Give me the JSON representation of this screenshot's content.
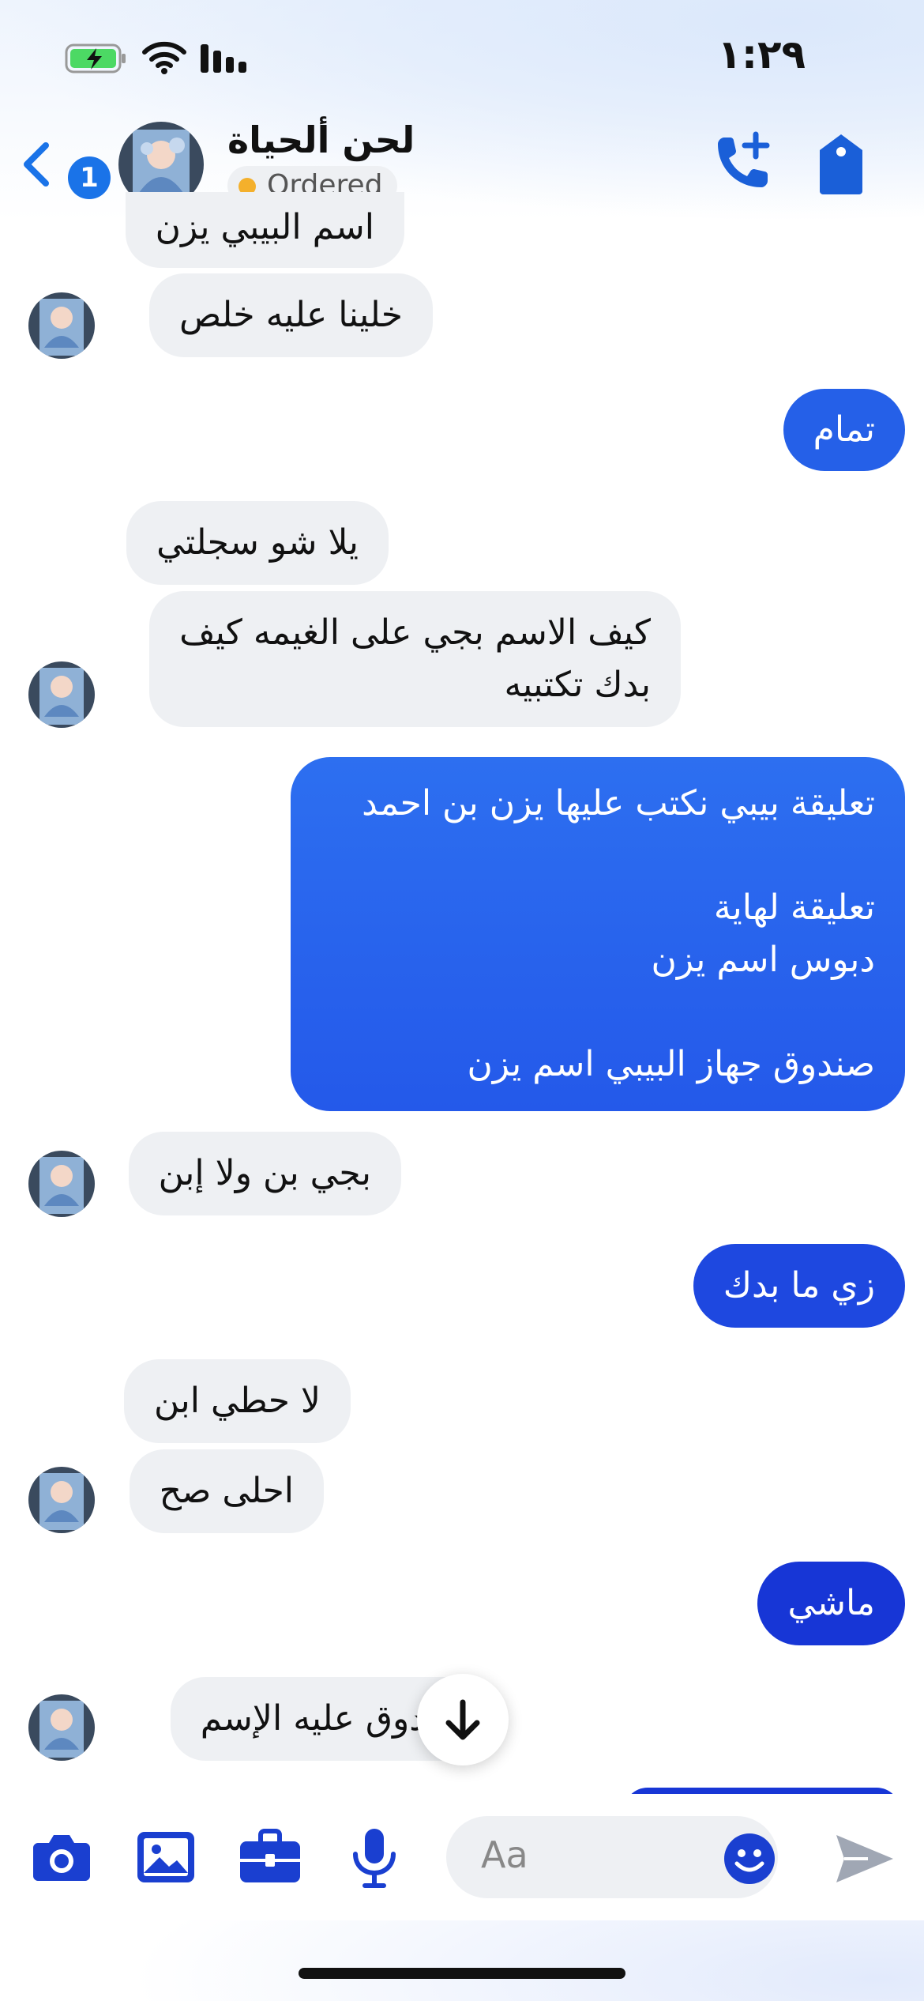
{
  "status_bar": {
    "time": "١:٢٩"
  },
  "header": {
    "contact_name": "لحن ألحياة",
    "status_chip": "Ordered",
    "unread_count": "1"
  },
  "messages": [
    {
      "side": "in",
      "text": "اسم البيبي يزن"
    },
    {
      "side": "in",
      "text": "خلينا عليه خلص"
    },
    {
      "side": "out",
      "text": "تمام"
    },
    {
      "side": "in",
      "text": "يلا شو سجلتي"
    },
    {
      "side": "in",
      "text": "كيف الاسم بجي على الغيمه كيف\nبدك تكتبيه"
    },
    {
      "side": "out",
      "text": "تعليقة بيبي نكتب عليها يزن بن احمد\n\nتعليقة لهاية\nدبوس اسم يزن\n\nصندوق جهاز البيبي اسم يزن"
    },
    {
      "side": "in",
      "text": "بجي بن ولا إبن"
    },
    {
      "side": "out",
      "text": "زي ما بدك"
    },
    {
      "side": "in",
      "text": "لا حطي ابن"
    },
    {
      "side": "in",
      "text": "احلى صح"
    },
    {
      "side": "out",
      "text": "ماشي"
    },
    {
      "side": "in",
      "text": "صندوق عليه الإسم"
    }
  ],
  "composer": {
    "placeholder": "Aa"
  },
  "colors": {
    "accent": "#1a5fd8",
    "outgoing_top": "#2e6cf0",
    "outgoing_bottom": "#1733d6",
    "incoming": "#eef0f3",
    "status_dot": "#f4b02c"
  },
  "icons": [
    "back-chevron-icon",
    "call-add-icon",
    "tag-icon",
    "camera-icon",
    "image-icon",
    "briefcase-icon",
    "microphone-icon",
    "emoji-icon",
    "send-icon",
    "scroll-down-arrow-icon"
  ]
}
